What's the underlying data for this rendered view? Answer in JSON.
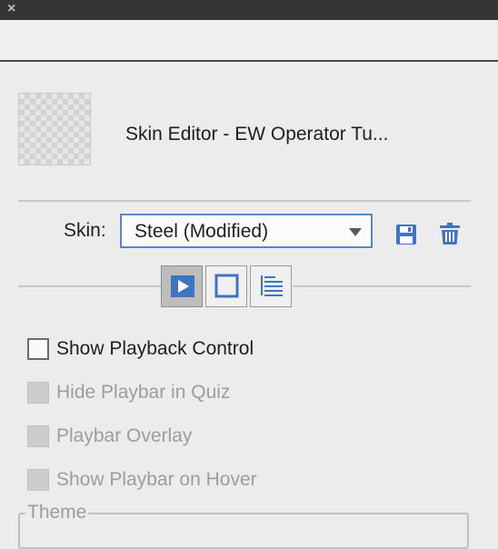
{
  "window": {
    "close_glyph": "×"
  },
  "header": {
    "title": "Skin Editor - EW Operator Tu..."
  },
  "skin": {
    "label": "Skin:",
    "selected": "Steel (Modified)",
    "save_icon": "floppy-save-icon",
    "delete_icon": "trash-icon"
  },
  "tabs": [
    {
      "name": "playback",
      "icon": "play-icon",
      "active": true
    },
    {
      "name": "borders",
      "icon": "square-border-icon",
      "active": false
    },
    {
      "name": "toc",
      "icon": "table-of-contents-icon",
      "active": false
    }
  ],
  "options": [
    {
      "label": "Show Playback Control",
      "checked": false,
      "enabled": true
    },
    {
      "label": "Hide Playbar in Quiz",
      "checked": false,
      "enabled": false
    },
    {
      "label": "Playbar Overlay",
      "checked": false,
      "enabled": false
    },
    {
      "label": "Show Playbar on Hover",
      "checked": false,
      "enabled": false
    }
  ],
  "theme": {
    "legend": "Theme"
  },
  "colors": {
    "accent": "#3f74c4",
    "active_tab": "#bdbdbd",
    "disabled_text": "#9d9d9d"
  }
}
